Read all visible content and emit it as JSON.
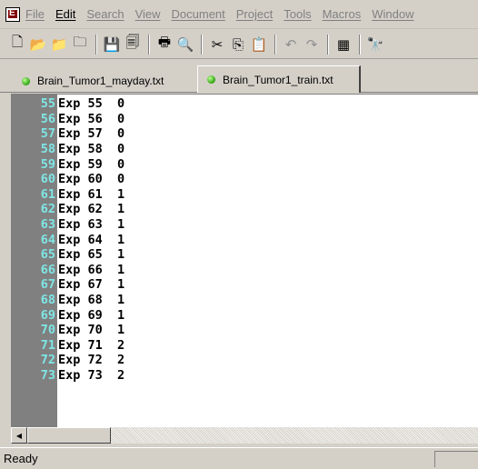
{
  "menu": [
    {
      "label": "File"
    },
    {
      "label": "Edit"
    },
    {
      "label": "Search"
    },
    {
      "label": "View"
    },
    {
      "label": "Document"
    },
    {
      "label": "Project"
    },
    {
      "label": "Tools"
    },
    {
      "label": "Macros"
    },
    {
      "label": "Window"
    }
  ],
  "toolbar": [
    {
      "icon": "new-file-icon",
      "glyph": "🗋"
    },
    {
      "icon": "open-folder-icon",
      "glyph": "📂"
    },
    {
      "icon": "open-remote-icon",
      "glyph": "📁"
    },
    {
      "icon": "close-file-icon",
      "glyph": "🗀"
    },
    {
      "sep": true
    },
    {
      "icon": "save-icon",
      "glyph": "💾"
    },
    {
      "icon": "save-all-icon",
      "glyph": "🗐"
    },
    {
      "sep": true
    },
    {
      "icon": "print-icon",
      "glyph": "🖶"
    },
    {
      "icon": "print-preview-icon",
      "glyph": "🔍"
    },
    {
      "sep": true
    },
    {
      "icon": "cut-icon",
      "glyph": "✂"
    },
    {
      "icon": "copy-icon",
      "glyph": "⎘"
    },
    {
      "icon": "paste-icon",
      "glyph": "📋"
    },
    {
      "sep": true
    },
    {
      "icon": "undo-icon",
      "glyph": "↶",
      "dim": true
    },
    {
      "icon": "redo-icon",
      "glyph": "↷",
      "dim": true
    },
    {
      "sep": true
    },
    {
      "icon": "column-mode-icon",
      "glyph": "▦"
    },
    {
      "sep": true
    },
    {
      "icon": "find-icon",
      "glyph": "🔭"
    }
  ],
  "tabs": [
    {
      "label": "Brain_Tumor1_mayday.txt",
      "active": false
    },
    {
      "label": "Brain_Tumor1_train.txt",
      "active": true
    }
  ],
  "editor": {
    "lines": [
      {
        "num": "55",
        "text": "Exp 55  0"
      },
      {
        "num": "56",
        "text": "Exp 56  0"
      },
      {
        "num": "57",
        "text": "Exp 57  0"
      },
      {
        "num": "58",
        "text": "Exp 58  0"
      },
      {
        "num": "59",
        "text": "Exp 59  0"
      },
      {
        "num": "60",
        "text": "Exp 60  0"
      },
      {
        "num": "61",
        "text": "Exp 61  1"
      },
      {
        "num": "62",
        "text": "Exp 62  1"
      },
      {
        "num": "63",
        "text": "Exp 63  1"
      },
      {
        "num": "64",
        "text": "Exp 64  1"
      },
      {
        "num": "65",
        "text": "Exp 65  1"
      },
      {
        "num": "66",
        "text": "Exp 66  1"
      },
      {
        "num": "67",
        "text": "Exp 67  1"
      },
      {
        "num": "68",
        "text": "Exp 68  1"
      },
      {
        "num": "69",
        "text": "Exp 69  1"
      },
      {
        "num": "70",
        "text": "Exp 70  1"
      },
      {
        "num": "71",
        "text": "Exp 71  2"
      },
      {
        "num": "72",
        "text": "Exp 72  2"
      },
      {
        "num": "73",
        "text": "Exp 73  2"
      }
    ]
  },
  "statusbar": {
    "text": "Ready"
  },
  "colors": {
    "gutter": "#808080",
    "line_number": "#7fe6e6",
    "chrome": "#d4d0c8"
  }
}
